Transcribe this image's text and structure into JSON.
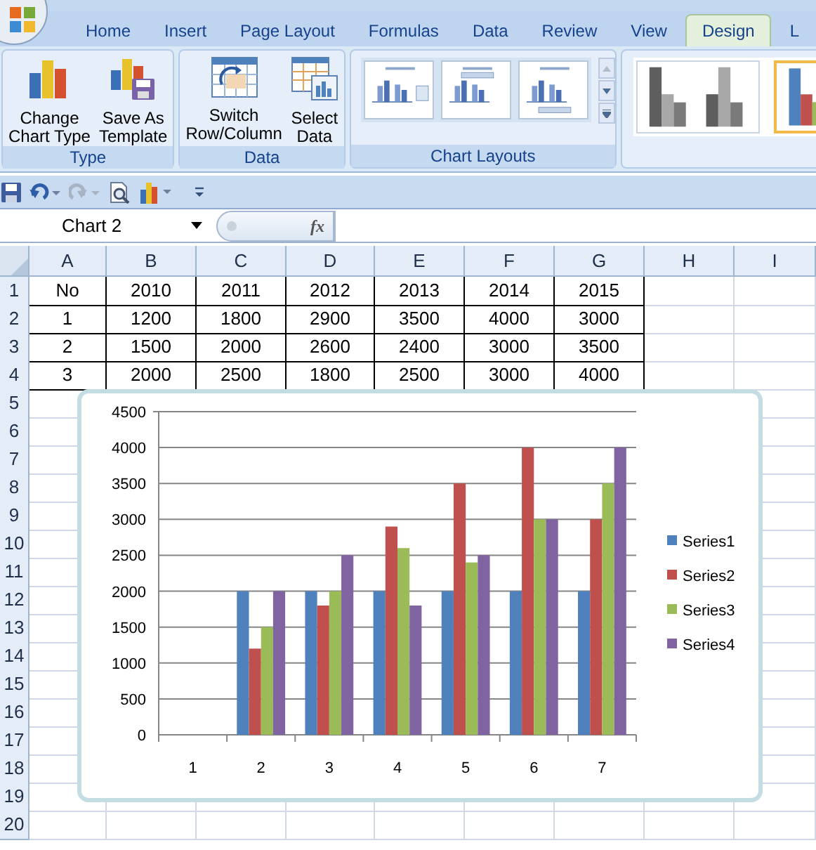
{
  "ribbon": {
    "tabs": [
      {
        "label": "Home",
        "selected": false
      },
      {
        "label": "Insert",
        "selected": false
      },
      {
        "label": "Page Layout",
        "selected": false
      },
      {
        "label": "Formulas",
        "selected": false
      },
      {
        "label": "Data",
        "selected": false
      },
      {
        "label": "Review",
        "selected": false
      },
      {
        "label": "View",
        "selected": false
      },
      {
        "label": "Design",
        "selected": true
      },
      {
        "label": "L",
        "selected": false
      }
    ],
    "groups": [
      {
        "label": "Type",
        "buttons": [
          {
            "kind": "change-type",
            "lines": [
              "Change",
              "Chart Type"
            ]
          },
          {
            "kind": "save-template",
            "lines": [
              "Save As",
              "Template"
            ]
          }
        ]
      },
      {
        "label": "Data",
        "buttons": [
          {
            "kind": "switch",
            "lines": [
              "Switch",
              "Row/Column"
            ]
          },
          {
            "kind": "select-data",
            "lines": [
              "Select",
              "Data"
            ]
          }
        ]
      }
    ],
    "chart_layouts": {
      "label": "Chart Layouts"
    },
    "chart_styles": [
      {
        "selected": false
      },
      {
        "selected": true
      }
    ]
  },
  "formula_bar": {
    "name_box": "Chart 2",
    "fx": "fx"
  },
  "sheet": {
    "columns": [
      "A",
      "B",
      "C",
      "D",
      "E",
      "F",
      "G",
      "H",
      "I"
    ],
    "rows": [
      {
        "number": "1",
        "cells": [
          "No",
          "2010",
          "2011",
          "2012",
          "2013",
          "2014",
          "2015"
        ]
      },
      {
        "number": "2",
        "cells": [
          "1",
          "1200",
          "1800",
          "2900",
          "3500",
          "4000",
          "3000"
        ]
      },
      {
        "number": "3",
        "cells": [
          "2",
          "1500",
          "2000",
          "2600",
          "2400",
          "3000",
          "3500"
        ]
      },
      {
        "number": "4",
        "cells": [
          "3",
          "2000",
          "2500",
          "1800",
          "2500",
          "3000",
          "4000"
        ]
      }
    ],
    "empty_rows": [
      "5",
      "6",
      "7",
      "8",
      "9",
      "10",
      "11",
      "12",
      "13",
      "14",
      "15",
      "16",
      "17",
      "18",
      "19",
      "20"
    ]
  },
  "chart": {
    "chart_data": {
      "type": "bar",
      "categories": [
        "1",
        "2",
        "3",
        "4",
        "5",
        "6",
        "7"
      ],
      "series": [
        {
          "name": "Series1",
          "color": "#4f81bd",
          "values": [
            null,
            2000,
            2000,
            2000,
            2000,
            2000,
            2000
          ]
        },
        {
          "name": "Series2",
          "color": "#c0504d",
          "values": [
            null,
            1200,
            1800,
            2900,
            3500,
            4000,
            3000
          ]
        },
        {
          "name": "Series3",
          "color": "#9bbb59",
          "values": [
            null,
            1500,
            2000,
            2600,
            2400,
            3000,
            3500
          ]
        },
        {
          "name": "Series4",
          "color": "#8064a2",
          "values": [
            null,
            2000,
            2500,
            1800,
            2500,
            3000,
            4000
          ]
        }
      ],
      "grid": true,
      "legend": true,
      "ylim": [
        0,
        4500
      ],
      "yticks": [
        0,
        500,
        1000,
        1500,
        2000,
        2500,
        3000,
        3500,
        4000,
        4500
      ]
    }
  }
}
